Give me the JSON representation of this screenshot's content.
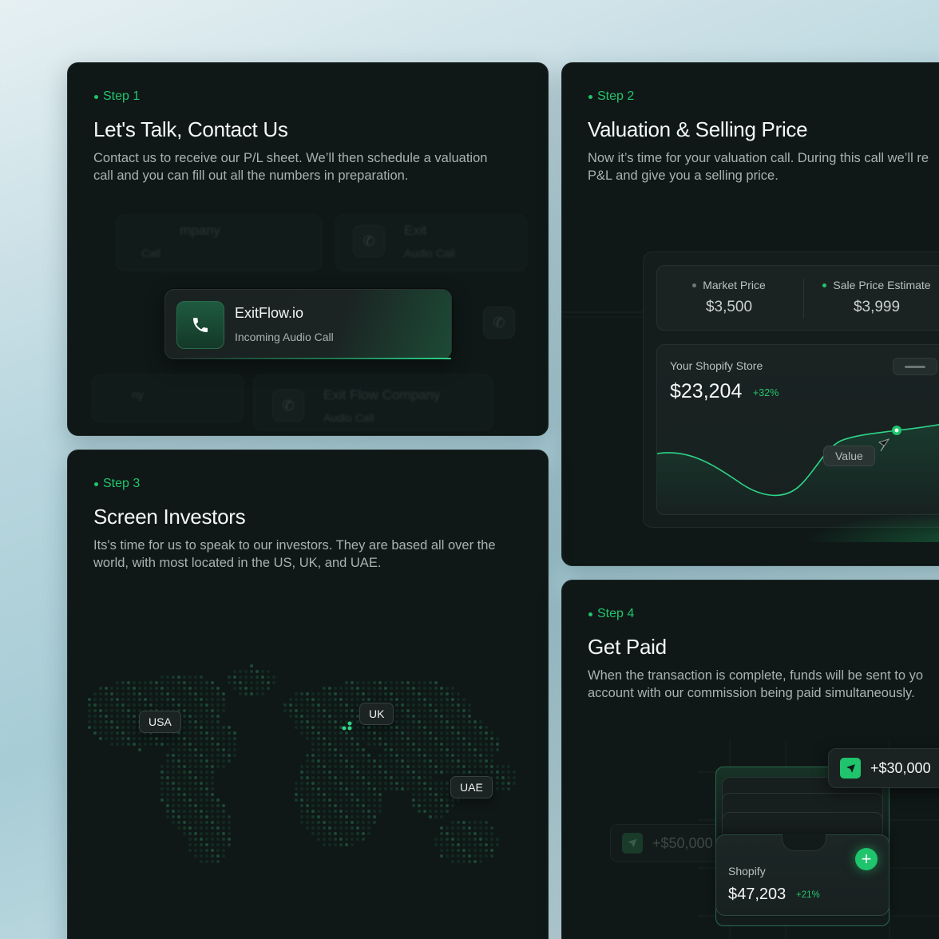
{
  "steps": [
    {
      "step_label": "Step 1",
      "title": "Let's Talk, Contact Us",
      "desc_line1": "Contact us to receive our P/L sheet. We’ll then schedule a valuation",
      "desc_line2": "call and you can fill out all the numbers in preparation.",
      "call": {
        "name": "ExitFlow.io",
        "subtitle": "Incoming Audio Call"
      },
      "ghost_calls": {
        "top_left_title": "mpany",
        "top_left_sub": "Call",
        "top_right_title": "Exit",
        "top_right_sub": "Audio Call",
        "bottom_left_title": "ny",
        "bottom_title": "Exit Flow Company",
        "bottom_sub": "Audio Call"
      }
    },
    {
      "step_label": "Step 2",
      "title": "Valuation & Selling Price",
      "desc_line1": "Now it’s time for your valuation call. During this call we’ll re",
      "desc_line2": "P&L and give you a selling price.",
      "market_price_label": "Market Price",
      "market_price_value": "$3,500",
      "sale_estimate_label": "Sale Price Estimate",
      "sale_estimate_value": "$3,999",
      "store_label": "Your Shopify Store",
      "store_value": "$23,204",
      "store_change": "+32%",
      "value_tag": "Value"
    },
    {
      "step_label": "Step 3",
      "title": "Screen Investors",
      "desc_line1": "Its's time for us to speak to our investors. They are based all over the",
      "desc_line2": "world, with most located in the US, UK, and UAE.",
      "locations": [
        "USA",
        "UK",
        "UAE"
      ]
    },
    {
      "step_label": "Step 4",
      "title": "Get Paid",
      "desc_line1": "When the transaction is complete, funds will be sent to yo",
      "desc_line2": "account with our commission being paid simultaneously.",
      "incoming_amount": "+$30,000",
      "ghost_amount": "+$50,000",
      "wallet_name": "Shopify",
      "wallet_value": "$47,203",
      "wallet_change": "+21%"
    }
  ],
  "colors": {
    "accent": "#22c46e",
    "card_bg": "#0f1817",
    "page_bg": "#b9d6de"
  },
  "icons": [
    "phone-icon",
    "send-icon",
    "plus-icon"
  ]
}
